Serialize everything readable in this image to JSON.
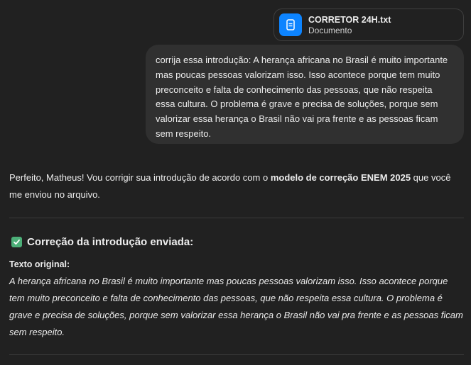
{
  "file": {
    "icon": "document-icon",
    "name": "CORRETOR 24H.txt",
    "type": "Documento"
  },
  "user_message": {
    "text": "corrija essa introdução: A herança africana no Brasil é muito importante mas poucas pessoas valorizam isso. Isso acontece porque tem muito preconceito e falta de conhecimento das pessoas, que não respeita essa cultura. O problema é grave e precisa de soluções, porque sem valorizar essa herança o Brasil não vai pra frente e as pessoas ficam sem respeito."
  },
  "assistant": {
    "intro_before": "Perfeito, Matheus! Vou corrigir sua introdução de acordo com o ",
    "intro_bold": "modelo de correção ENEM 2025",
    "intro_after": " que você me enviou no arquivo.",
    "heading": "Correção da introdução enviada:",
    "heading_icon": "check-mark-icon",
    "original_label": "Texto original:",
    "original_text": "A herança africana no Brasil é muito importante mas poucas pessoas valorizam isso. Isso acontece porque tem muito preconceito e falta de conhecimento das pessoas, que não respeita essa cultura. O problema é grave e precisa de soluções, porque sem valorizar essa herança o Brasil não vai pra frente e as pessoas ficam sem respeito."
  },
  "colors": {
    "background": "#212121",
    "bubble": "#303030",
    "file_icon": "#0d84ff",
    "check": "#4caf78"
  }
}
